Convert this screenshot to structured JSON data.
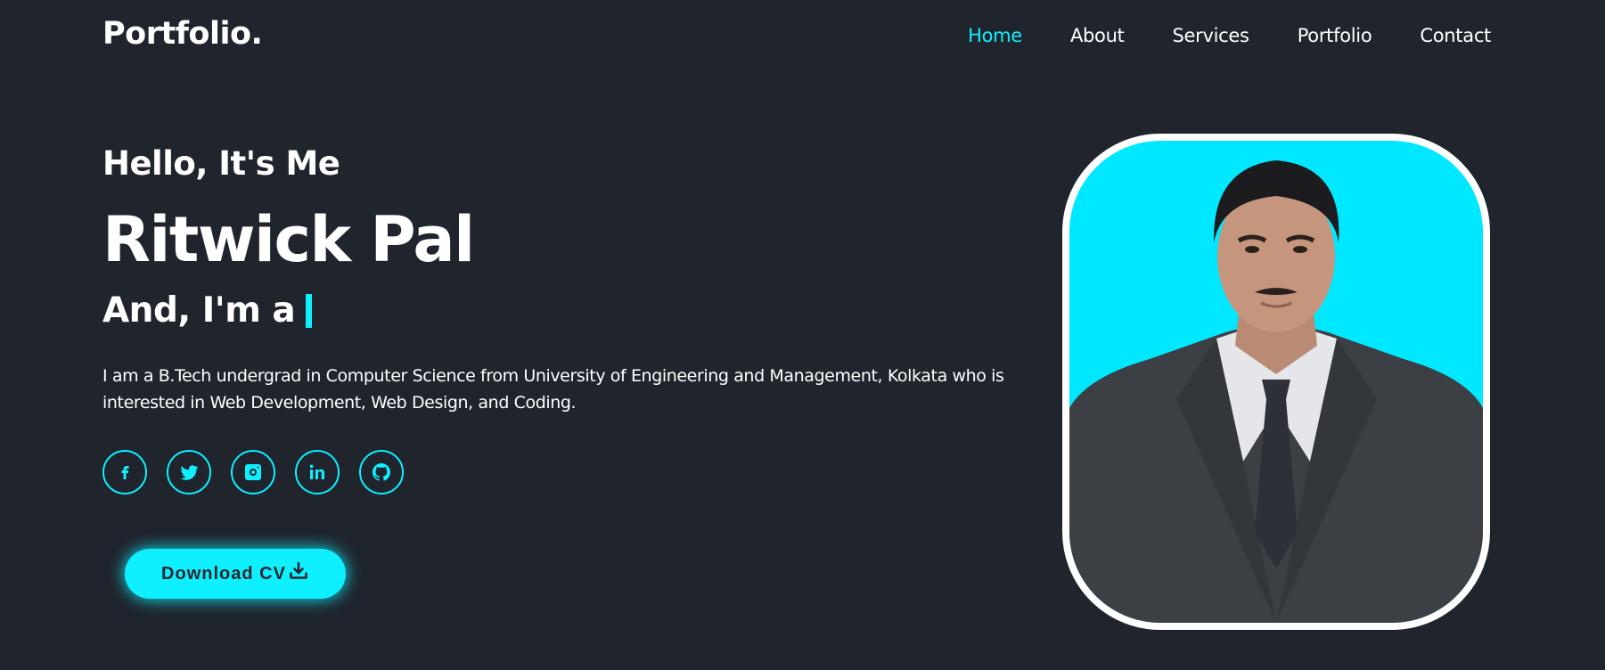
{
  "header": {
    "logo": "Portfolio.",
    "nav": [
      {
        "label": "Home",
        "active": true
      },
      {
        "label": "About",
        "active": false
      },
      {
        "label": "Services",
        "active": false
      },
      {
        "label": "Portfolio",
        "active": false
      },
      {
        "label": "Contact",
        "active": false
      }
    ]
  },
  "hero": {
    "greeting": "Hello, It's Me",
    "name": "Ritwick Pal",
    "role_prefix": "And, I'm a",
    "bio": "I am a B.Tech undergrad in Computer Science from University of Engineering and Management, Kolkata who is interested in Web Development, Web Design, and Coding.",
    "socials": [
      "facebook-icon",
      "twitter-icon",
      "instagram-icon",
      "linkedin-icon",
      "github-icon"
    ],
    "cta_label": "Download CV",
    "cta_icon": "download-icon"
  },
  "colors": {
    "background": "#1f242d",
    "accent": "#0ef0ff",
    "text": "#ffffff"
  }
}
